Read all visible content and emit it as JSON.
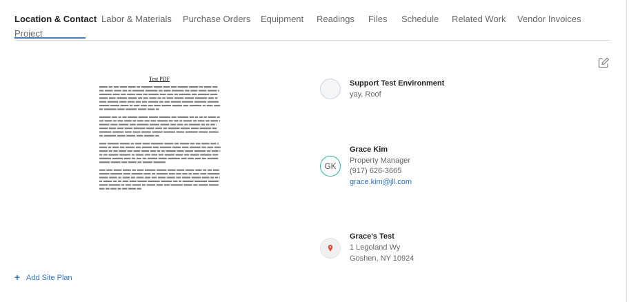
{
  "tabs": [
    {
      "label": "Location & Contact",
      "active": true
    },
    {
      "label": "Labor & Materials"
    },
    {
      "label": "Purchase Orders"
    },
    {
      "label": "Equipment"
    },
    {
      "label": "Readings"
    },
    {
      "label": "Files"
    },
    {
      "label": "Schedule"
    },
    {
      "label": "Related Work"
    },
    {
      "label": "Vendor Invoices"
    },
    {
      "label": "Project"
    }
  ],
  "site_plan": {
    "pdf_title": "Test PDF",
    "add_label": "Add Site Plan"
  },
  "client": {
    "name": "Support Test Environment",
    "detail": "yay, Roof"
  },
  "contact": {
    "initials": "GK",
    "name": "Grace Kim",
    "role": "Property Manager",
    "phone": "(917) 626-3665",
    "email": "grace.kim@jll.com"
  },
  "location": {
    "name": "Grace's Test",
    "address_line1": "1 Legoland Wy",
    "address_line2": "Goshen, NY 10924"
  },
  "colors": {
    "accent": "#3b7dd8",
    "link": "#2f74c9",
    "avatar_ring": "#2bb3a3",
    "pin": "#e0453a"
  },
  "icons": {
    "edit": "edit-square-icon",
    "add": "plus-icon",
    "location": "map-pin-icon"
  }
}
